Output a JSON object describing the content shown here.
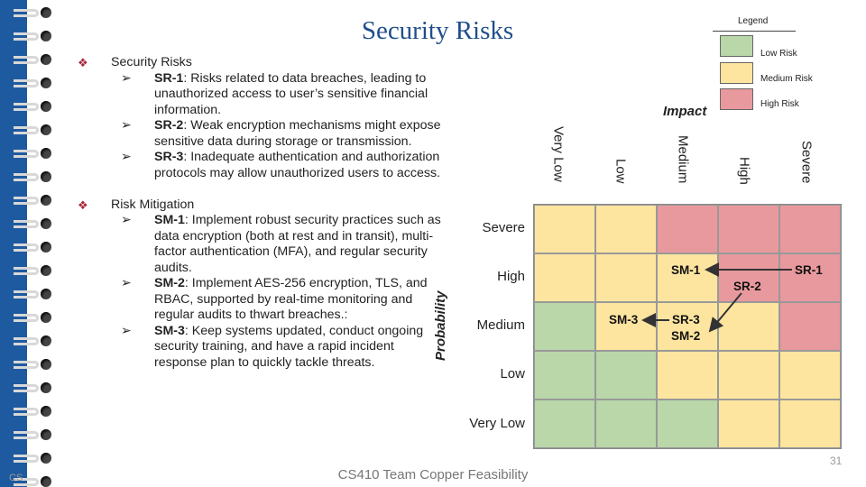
{
  "slide": {
    "title": "Security Risks",
    "page_number": "31",
    "footer": "CS410 Team Copper Feasibility",
    "corner_text": "CS"
  },
  "bullets": {
    "risks_heading": "Security Risks",
    "risks": [
      {
        "id": "SR-1",
        "text": ": Risks related to data breaches, leading to unauthorized access to user’s sensitive financial information."
      },
      {
        "id": "SR-2",
        "text": ": Weak encryption mechanisms might expose sensitive data during storage or transmission."
      },
      {
        "id": "SR-3",
        "text": ": Inadequate authentication and authorization protocols may allow unauthorized users to access."
      }
    ],
    "mitigation_heading": "Risk Mitigation",
    "mitigations": [
      {
        "id": "SM-1",
        "text": ": Implement robust security practices such as data encryption (both at rest and in transit), multi-factor authentication (MFA), and regular security audits."
      },
      {
        "id": "SM-2",
        "text": ": Implement AES-256 encryption, TLS, and RBAC, supported by real-time monitoring and regular audits to thwart breaches.:"
      },
      {
        "id": "SM-3",
        "text": ": Keep systems updated, conduct ongoing security training, and have a rapid incident response plan to quickly tackle threats."
      }
    ]
  },
  "legend": {
    "title": "Legend",
    "items": [
      {
        "label": "Low Risk",
        "color": "#b9d7a8"
      },
      {
        "label": "Medium Risk",
        "color": "#fde59f"
      },
      {
        "label": "High Risk",
        "color": "#e8999d"
      }
    ]
  },
  "matrix": {
    "impact_title": "Impact",
    "probability_title": "Probability",
    "impact_levels": [
      "Very Low",
      "Low",
      "Medium",
      "High",
      "Severe"
    ],
    "probability_levels": [
      "Severe",
      "High",
      "Medium",
      "Low",
      "Very Low"
    ],
    "cells": [
      [
        "med",
        "med",
        "high",
        "high",
        "high"
      ],
      [
        "med",
        "med",
        "med",
        "high",
        "high"
      ],
      [
        "low",
        "med",
        "med",
        "med",
        "high"
      ],
      [
        "low",
        "low",
        "med",
        "med",
        "med"
      ],
      [
        "low",
        "low",
        "low",
        "med",
        "med"
      ]
    ],
    "tags": {
      "sm1": "SM-1",
      "sr1": "SR-1",
      "sr2": "SR-2",
      "sm3": "SM-3",
      "sr3": "SR-3",
      "sm2": "SM-2"
    }
  }
}
